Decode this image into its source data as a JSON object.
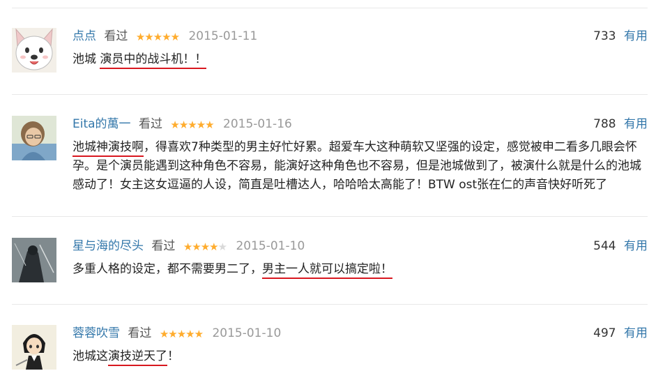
{
  "colors": {
    "link": "#3377aa",
    "star": "#ffac2d",
    "underline": "#d8171f"
  },
  "reviews": [
    {
      "user": "点点",
      "status": "看过",
      "rating": 5,
      "date": "2015-01-11",
      "votes": "733",
      "useful_label": "有用",
      "content_before": "池城 ",
      "content_highlight": "演员中的战斗机！！",
      "content_after": ""
    },
    {
      "user": "Eita的萬一",
      "status": "看过",
      "rating": 5,
      "date": "2015-01-16",
      "votes": "788",
      "useful_label": "有用",
      "content_before": "",
      "content_highlight": "池城神演技啊",
      "content_after": "，得喜欢7种类型的男主好忙好累。超爱车大这种萌软又坚强的设定，感觉被申二看多几眼会怀孕。是个演员能遇到这种角色不容易，能演好这种角色也不容易，但是池城做到了，被演什么就是什么的池城感动了！女主这女逗逼的人设，简直是吐槽达人，哈哈哈太高能了！BTW ost张在仁的声音快好听死了"
    },
    {
      "user": "星与海的尽头",
      "status": "看过",
      "rating": 4,
      "date": "2015-01-10",
      "votes": "544",
      "useful_label": "有用",
      "content_before": "多重人格的设定，都不需要男二了，",
      "content_highlight": "男主一人就可以搞定啦！",
      "content_after": ""
    },
    {
      "user": "蓉蓉吹雪",
      "status": "看过",
      "rating": 5,
      "date": "2015-01-10",
      "votes": "497",
      "useful_label": "有用",
      "content_before": "池城这",
      "content_highlight": "演技逆天了",
      "content_after": "！"
    }
  ]
}
